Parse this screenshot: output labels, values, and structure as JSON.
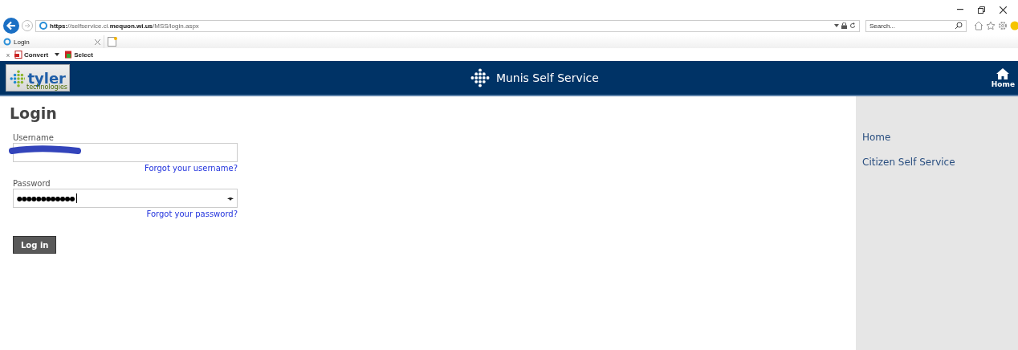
{
  "browser": {
    "url": "**https:**//selfservice.ci.**mequon.wi.us**/MSS/login.aspx",
    "search_placeholder": "Search...",
    "tab": {
      "title": "Login"
    },
    "commands": [
      "Convert",
      "Select"
    ],
    "close_command": "x"
  },
  "header": {
    "logo": "tyler",
    "logo_sub": "technologies",
    "title": "Munis Self Service",
    "home": "Home"
  },
  "login": {
    "title": "Login",
    "fields": [
      {
        "label": "Username",
        "kind": "text",
        "redacted": true,
        "link": "Forgot your username?"
      },
      {
        "label": "Password",
        "kind": "password",
        "value": "●●●●●●●●●●●●",
        "link": "Forgot your password?"
      }
    ],
    "button": "Log in"
  },
  "sidebar": {
    "items": [
      {
        "label": "Home"
      },
      {
        "label": "Citizen Self Service"
      }
    ]
  }
}
